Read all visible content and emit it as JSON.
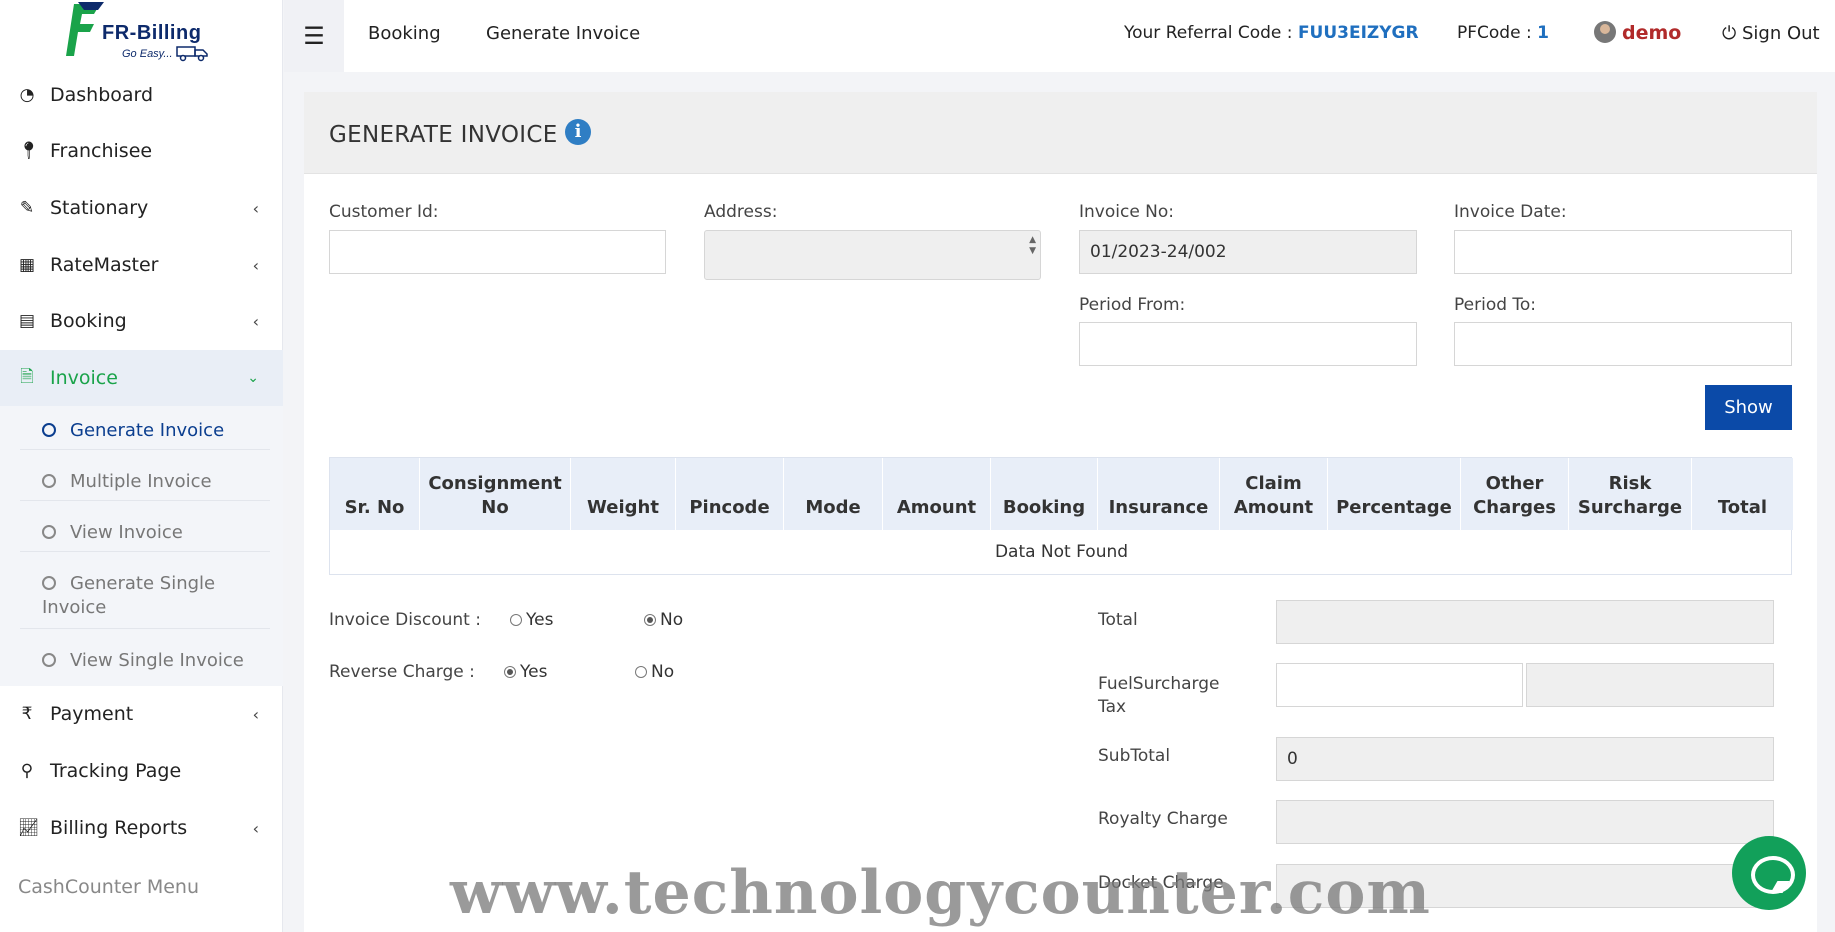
{
  "brand": {
    "name": "FR-Billing",
    "tagline": "Go Easy..."
  },
  "sidebar": {
    "items": [
      {
        "label": "Dashboard",
        "icon": "dashboard-icon"
      },
      {
        "label": "Franchisee",
        "icon": "map-pin-icon"
      },
      {
        "label": "Stationary",
        "icon": "edit-icon"
      },
      {
        "label": "RateMaster",
        "icon": "calculator-icon"
      },
      {
        "label": "Booking",
        "icon": "id-card-icon"
      },
      {
        "label": "Invoice",
        "icon": "file-pdf-icon"
      },
      {
        "label": "Payment",
        "icon": "rupee-icon"
      },
      {
        "label": "Tracking Page",
        "icon": "search-icon"
      },
      {
        "label": "Billing Reports",
        "icon": "line-chart-icon"
      }
    ],
    "invoice_sub": [
      "Generate Invoice",
      "Multiple Invoice",
      "View Invoice",
      "Generate Single Invoice",
      "View Single Invoice"
    ],
    "cash_counter": "CashCounter Menu"
  },
  "topbar": {
    "links": [
      "Booking",
      "Generate Invoice"
    ],
    "referral_label": "Your Referral Code :",
    "referral_code": "FUU3EIZYGR",
    "pfcode_label": "PFCode :",
    "pfcode": "1",
    "user": "demo",
    "signout": "Sign Out"
  },
  "page": {
    "title": "GENERATE INVOICE",
    "customer_id_label": "Customer Id:",
    "address_label": "Address:",
    "invoice_no_label": "Invoice No:",
    "invoice_no_value": "01/2023-24/002",
    "invoice_date_label": "Invoice Date:",
    "period_from_label": "Period From:",
    "period_to_label": "Period To:",
    "show_button": "Show"
  },
  "table": {
    "headers": [
      "Sr. No",
      "Consignment No",
      "Weight",
      "Pincode",
      "Mode",
      "Amount",
      "Booking",
      "Insurance",
      "Claim Amount",
      "Percentage",
      "Other Charges",
      "Risk Surcharge",
      "Total"
    ],
    "empty_message": "Data Not Found"
  },
  "summary": {
    "invoice_discount_label": "Invoice Discount :",
    "reverse_charge_label": "Reverse Charge :",
    "yes": "Yes",
    "no": "No",
    "invoice_discount_selected": "No",
    "reverse_charge_selected": "Yes",
    "total_label": "Total",
    "fuel_label": "FuelSurcharge Tax",
    "subtotal_label": "SubTotal",
    "subtotal_value": "0",
    "royalty_label": "Royalty Charge",
    "docket_label": "Docket Charge"
  },
  "watermark": "www.technologycounter.com"
}
